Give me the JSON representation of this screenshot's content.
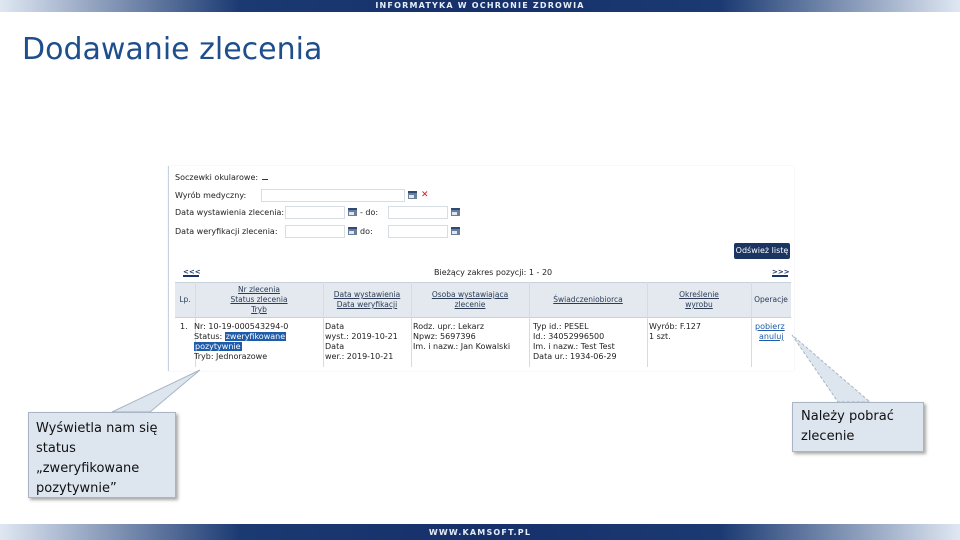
{
  "banner": {
    "top_text": "INFORMATYKA W OCHRONIE ZDROWIA",
    "bottom_text": "WWW.KAMSOFT.PL"
  },
  "slide": {
    "title": "Dodawanie zlecenia"
  },
  "form": {
    "soczewki_label": "Soczewki okularowe:",
    "wyrob_label": "Wyrób medyczny:",
    "data_wystawienia_label": "Data wystawienia zlecenia:",
    "data_weryfikacji_label": "Data weryfikacji zlecenia:",
    "do_label": "- do:",
    "do_label_2": "do:",
    "refresh_button": "Odśwież listę"
  },
  "pager": {
    "prev": "<<<",
    "next": ">>>",
    "range_text": "Bieżący zakres pozycji: 1 - 20"
  },
  "table": {
    "headers": {
      "lp": "Lp.",
      "nr_line1": "Nr zlecenia",
      "nr_line2": "Status zlecenia",
      "nr_line3": "Tryb",
      "data_line1": "Data wystawienia",
      "data_line2": "Data weryfikacji",
      "osoba_line1": "Osoba wystawiająca",
      "osoba_line2": "zlecenie",
      "swiadczeniobiorca": "Świadczeniobiorca",
      "okreslenie_line1": "Określenie",
      "okreslenie_line2": "wyrobu",
      "operacje": "Operacje"
    },
    "row": {
      "lp": "1.",
      "nr": "Nr: 10-19-000543294-0",
      "status_prefix": "Status: ",
      "status_value_1": "zweryfikowane",
      "status_value_2": "pozytywnie",
      "tryb": "Tryb: Jednorazowe",
      "data_1": "Data",
      "data_2": "wyst.: 2019-10-21",
      "data_3": "Data",
      "data_4": "wer.: 2019-10-21",
      "osoba_1": "Rodz. upr.: Lekarz",
      "osoba_2": "Npwz: 5697396",
      "osoba_3": "Im. i nazw.: Jan Kowalski",
      "swiad_1": "Typ id.: PESEL",
      "swiad_2": "Id.: 34052996500",
      "swiad_3": "Im. i nazw.: Test Test",
      "swiad_4": "Data ur.: 1934-06-29",
      "wyrob_1": "Wyrób: F.127",
      "wyrob_2": "1 szt.",
      "op_1": "pobierz",
      "op_2": "anuluj"
    }
  },
  "callouts": {
    "left_text": "Wyświetla nam się status „zweryfikowane pozytywnie”",
    "right_text": "Należy pobrać zlecenie"
  },
  "colors": {
    "title": "#1f4e8c",
    "banner": "#16306a",
    "highlight": "#1e5ba8",
    "callout_bg": "#dde5ef"
  }
}
